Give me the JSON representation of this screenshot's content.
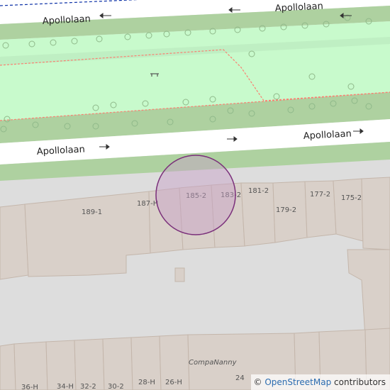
{
  "map": {
    "streets": {
      "top": "Apollolaan",
      "bottom": "Apollolaan"
    },
    "house_numbers": {
      "n189": "189-1",
      "n187": "187-H",
      "n185": "185-2",
      "n183": "183-2",
      "n181": "181-2",
      "n179": "179-2",
      "n177": "177-2",
      "n175": "175-2",
      "n36": "36-H",
      "n34": "34-H",
      "n32": "32-2",
      "n30": "30-2",
      "n28": "28-H",
      "n26": "26-H",
      "n24": "24"
    },
    "poi": {
      "business": "CompaNanny"
    },
    "attribution": {
      "prefix": "©",
      "link": "OpenStreetMap",
      "suffix": " contributors"
    },
    "colors": {
      "park": "#c8facc",
      "grass_strip": "#aed1a0",
      "road": "#ffffff",
      "building": "#d9d0c9",
      "building_outline": "#c4b6ab",
      "paved_area": "#dddddd",
      "bus_route": "#0a2fa6",
      "footpath": "#fa8072",
      "marker_fill": "rgba(200,160,200,0.45)",
      "marker_stroke": "#7a2f7a"
    }
  }
}
